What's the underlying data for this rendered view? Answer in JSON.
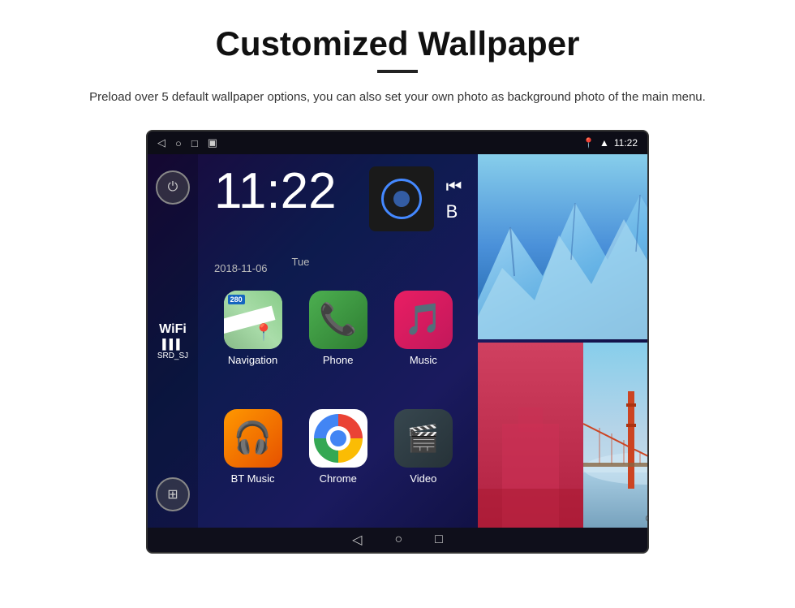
{
  "header": {
    "title": "Customized Wallpaper",
    "description": "Preload over 5 default wallpaper options, you can also set your own photo as background photo of the main menu."
  },
  "device": {
    "time": "11:22",
    "date": "2018-11-06",
    "day": "Tue",
    "wifi_label": "WiFi",
    "wifi_network": "SRD_SJ",
    "apps": [
      {
        "label": "Navigation",
        "icon_type": "navigation"
      },
      {
        "label": "Phone",
        "icon_type": "phone"
      },
      {
        "label": "Music",
        "icon_type": "music"
      },
      {
        "label": "BT Music",
        "icon_type": "bt_music"
      },
      {
        "label": "Chrome",
        "icon_type": "chrome"
      },
      {
        "label": "Video",
        "icon_type": "video"
      }
    ]
  },
  "wallpapers": {
    "car_setting_label": "CarSetting"
  },
  "status_bar": {
    "time": "11:22"
  }
}
